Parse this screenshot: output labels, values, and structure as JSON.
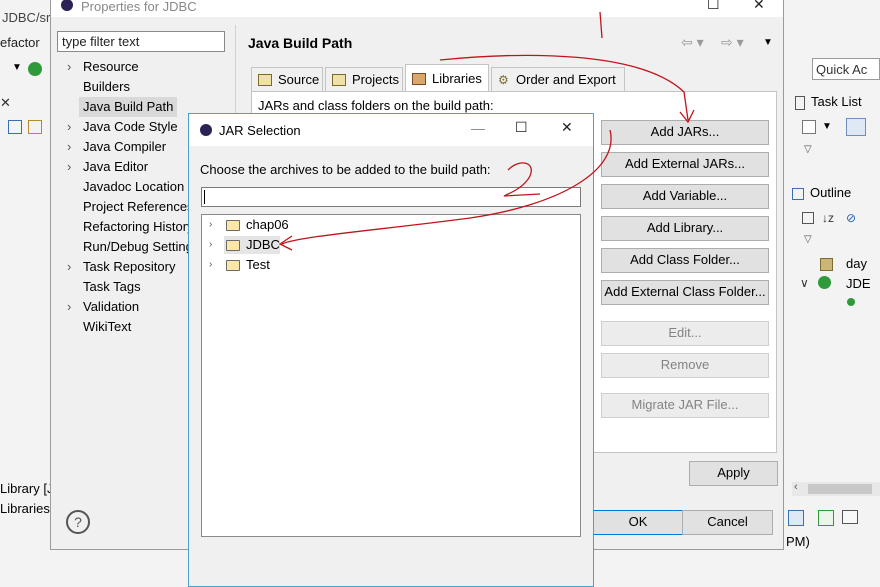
{
  "background_ide": {
    "crumb": "JDBC/sr",
    "menu_refactor": "efactor",
    "quick_access": "Quick Ac",
    "task_list": "Task List",
    "outline": "Outline",
    "outline_day": "day",
    "outline_jdb": "JDE",
    "bottom_library": "Library [J",
    "bottom_libraries": "Libraries",
    "status_time": "PM)"
  },
  "properties": {
    "title": "Properties for JDBC",
    "filter_placeholder": "type filter text",
    "nav": [
      {
        "label": "Resource",
        "expandable": true
      },
      {
        "label": "Builders",
        "expandable": false
      },
      {
        "label": "Java Build Path",
        "expandable": false,
        "selected": true
      },
      {
        "label": "Java Code Style",
        "expandable": true
      },
      {
        "label": "Java Compiler",
        "expandable": true
      },
      {
        "label": "Java Editor",
        "expandable": true
      },
      {
        "label": "Javadoc Location",
        "expandable": false
      },
      {
        "label": "Project References",
        "expandable": false
      },
      {
        "label": "Refactoring History",
        "expandable": false
      },
      {
        "label": "Run/Debug Settings",
        "expandable": false
      },
      {
        "label": "Task Repository",
        "expandable": true
      },
      {
        "label": "Task Tags",
        "expandable": false
      },
      {
        "label": "Validation",
        "expandable": true
      },
      {
        "label": "WikiText",
        "expandable": false
      }
    ],
    "page_title": "Java Build Path",
    "tabs": [
      "Source",
      "Projects",
      "Libraries",
      "Order and Export"
    ],
    "active_tab": "Libraries",
    "jars_label": "JARs and class folders on the build path:",
    "buttons": {
      "add_jars": "Add JARs...",
      "add_external_jars": "Add External JARs...",
      "add_variable": "Add Variable...",
      "add_library": "Add Library...",
      "add_class_folder": "Add Class Folder...",
      "add_external_class_folder": "Add External Class Folder...",
      "edit": "Edit...",
      "remove": "Remove",
      "migrate": "Migrate JAR File...",
      "apply": "Apply",
      "ok": "OK",
      "cancel": "Cancel"
    }
  },
  "jar_dialog": {
    "title": "JAR Selection",
    "prompt": "Choose the archives to be added to the build path:",
    "input_value": "",
    "tree": [
      "chap06",
      "JDBC",
      "Test"
    ],
    "selected": "JDBC"
  },
  "annotations": {
    "step1": "1",
    "step2": "2"
  },
  "colors": {
    "dialog_border": "#4aa0c8",
    "annotation": "#c0141c",
    "button_bg": "#e1e1e1"
  }
}
